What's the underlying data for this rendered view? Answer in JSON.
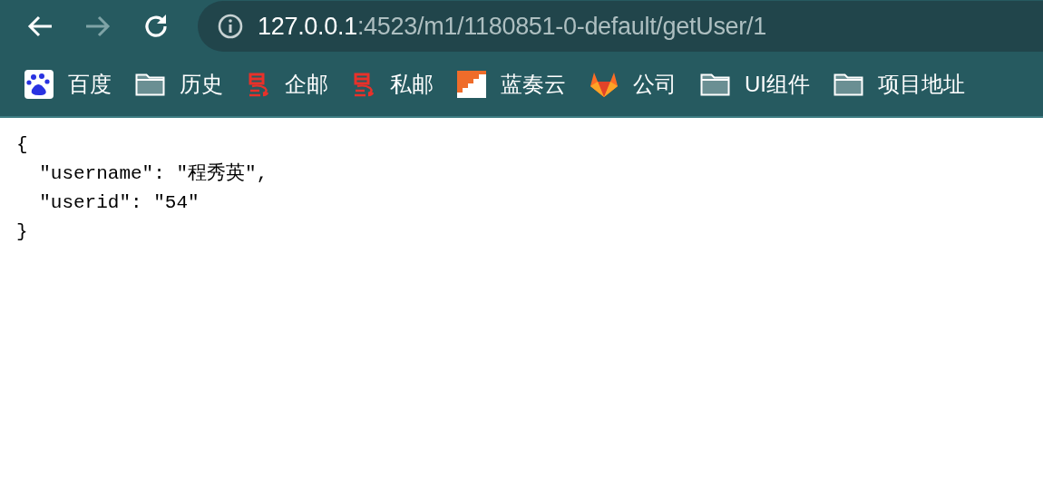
{
  "nav": {
    "back": {
      "disabled": false
    },
    "forward": {
      "disabled": true
    }
  },
  "address_bar": {
    "host": "127.0.0.1",
    "path": ":4523/m1/1180851-0-default/getUser/1"
  },
  "bookmarks": [
    {
      "label": "百度",
      "kind": "baidu"
    },
    {
      "label": "历史",
      "kind": "folder"
    },
    {
      "label": "企邮",
      "kind": "mail"
    },
    {
      "label": "私邮",
      "kind": "mail"
    },
    {
      "label": "蓝奏云",
      "kind": "lanzou"
    },
    {
      "label": "公司",
      "kind": "gitlab"
    },
    {
      "label": "UI组件",
      "kind": "folder"
    },
    {
      "label": "项目地址",
      "kind": "folder"
    }
  ],
  "content": {
    "lines": [
      "{",
      "  \"username\": \"程秀英\",",
      "  \"userid\": \"54\"",
      "}"
    ]
  }
}
